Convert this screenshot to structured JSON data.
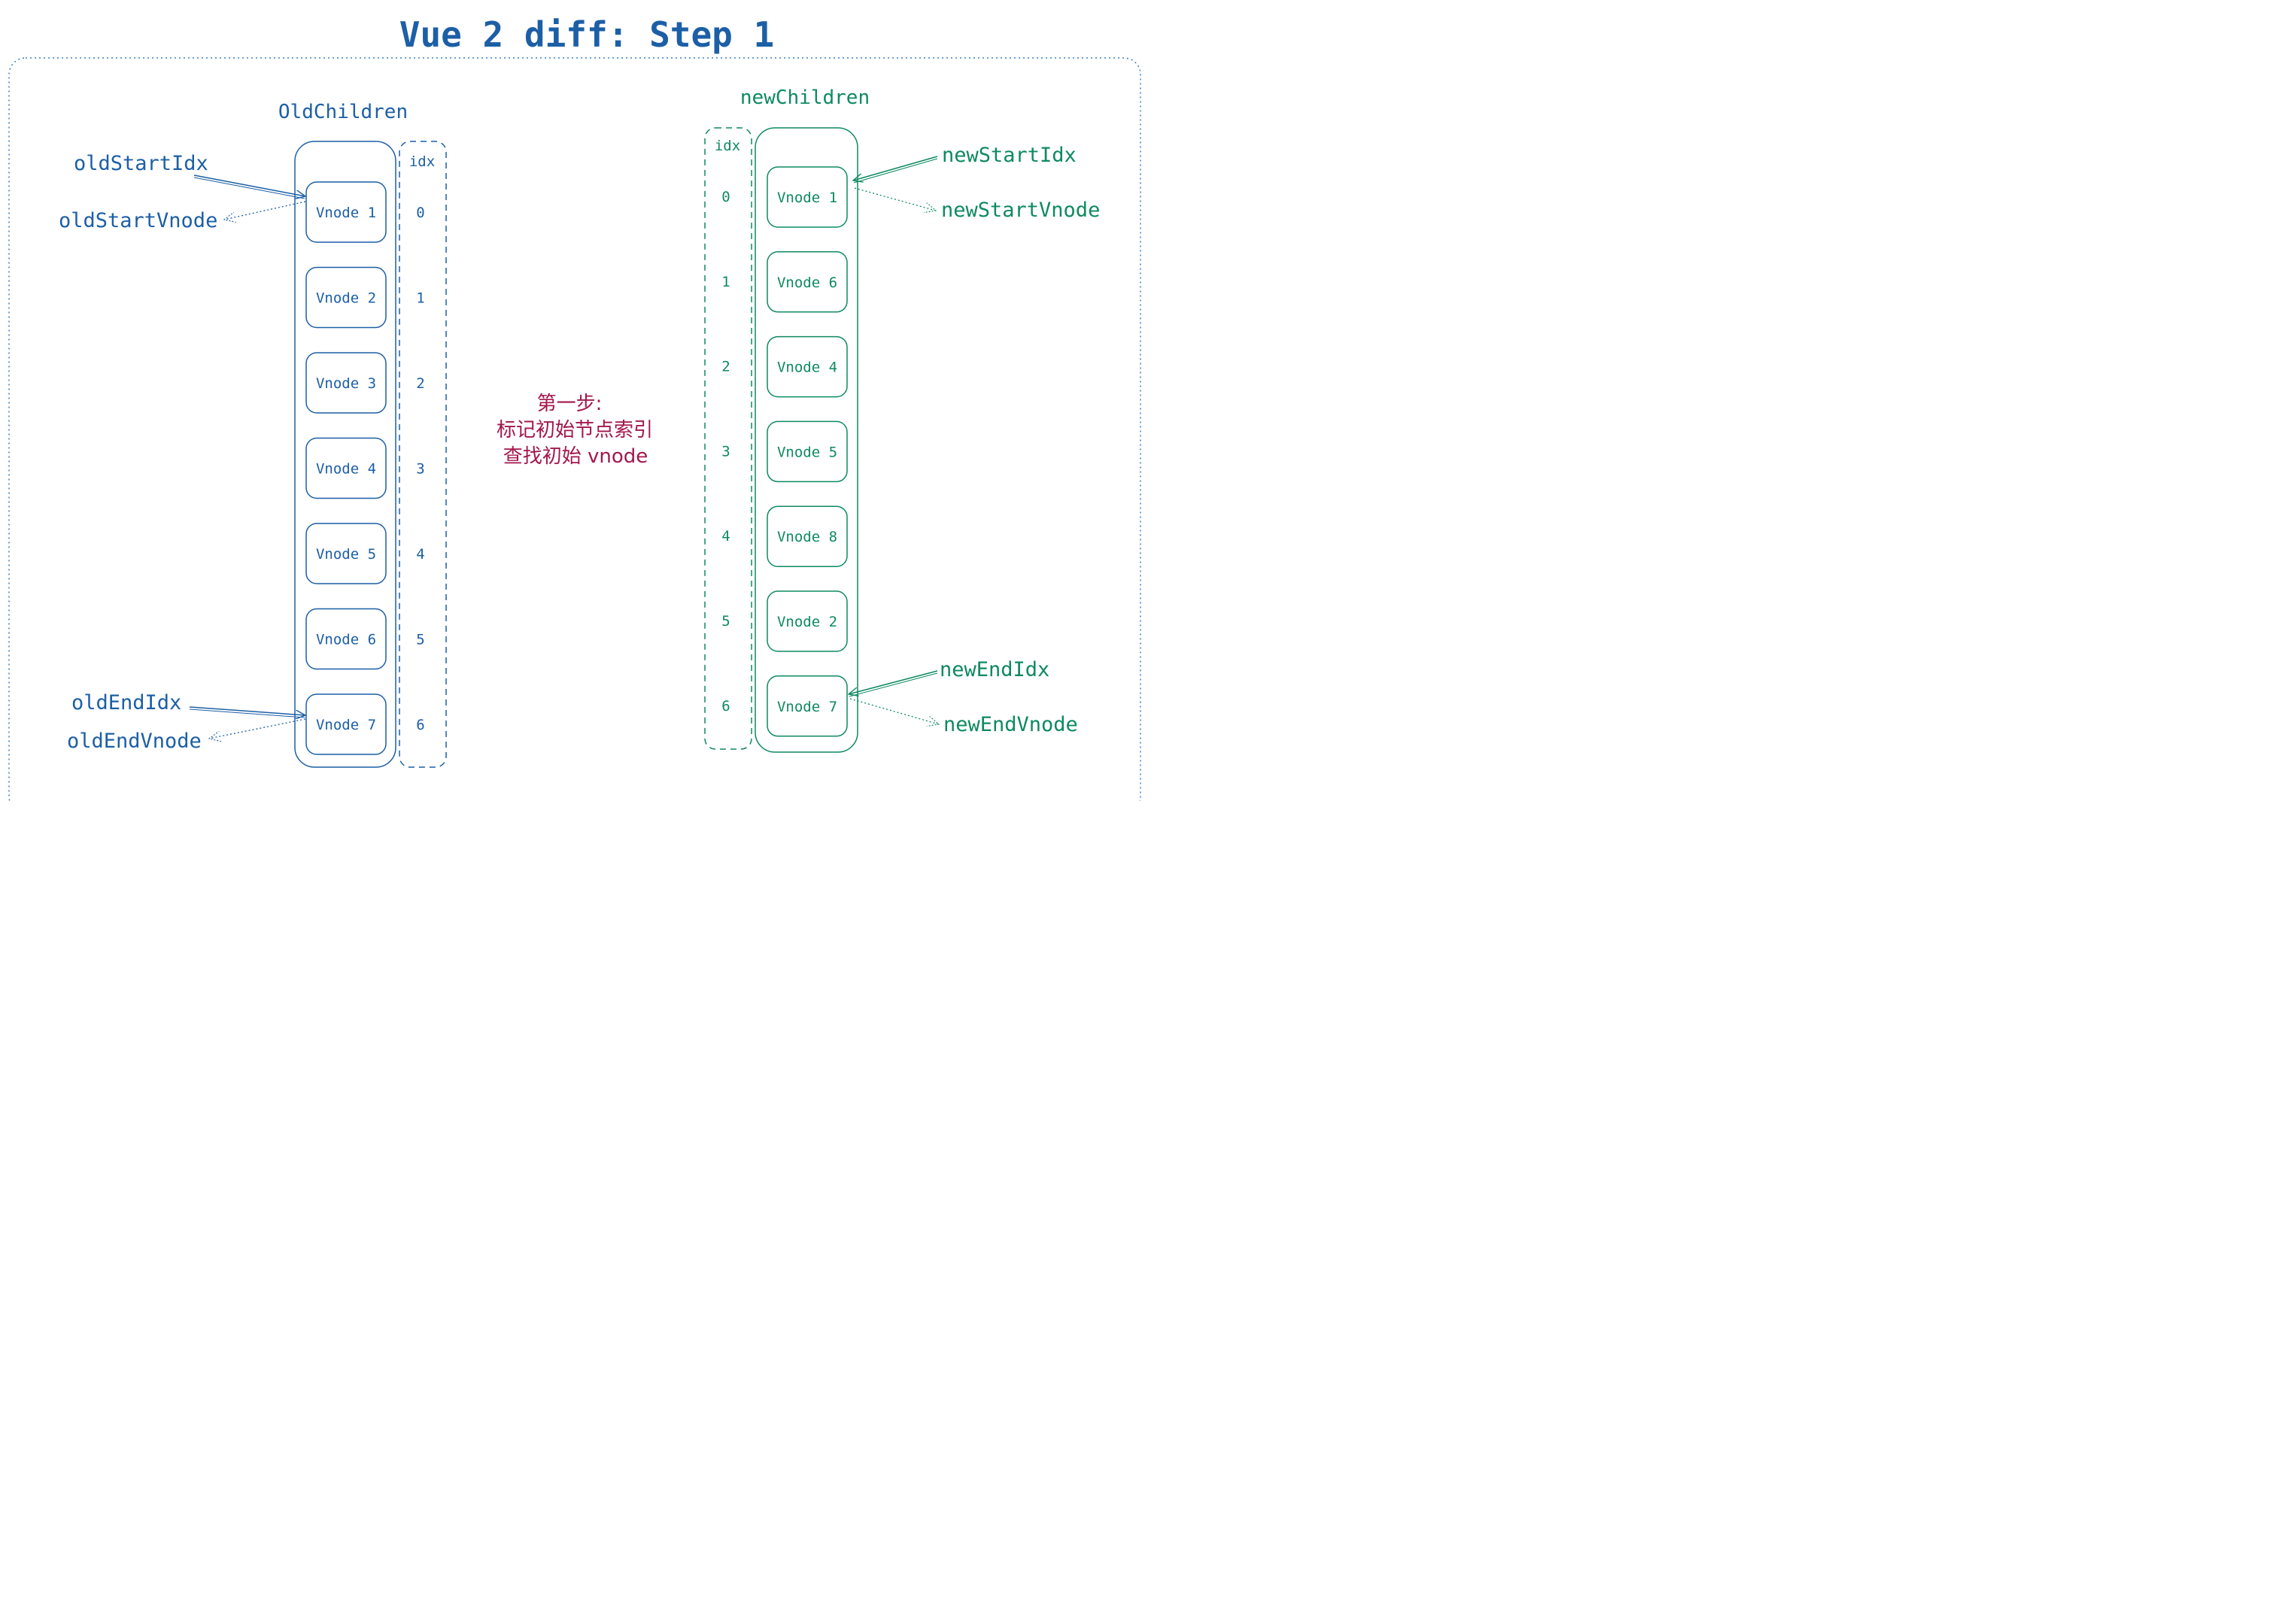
{
  "title": "Vue 2 diff: Step 1",
  "colors": {
    "blue": "#1c5fa6",
    "green": "#0e8a5f",
    "crimson": "#a3174a",
    "frame": "#3a7fc0"
  },
  "old": {
    "heading": "OldChildren",
    "idx_header": "idx",
    "nodes": [
      "Vnode 1",
      "Vnode 2",
      "Vnode 3",
      "Vnode 4",
      "Vnode 5",
      "Vnode 6",
      "Vnode 7"
    ],
    "indices": [
      "0",
      "1",
      "2",
      "3",
      "4",
      "5",
      "6"
    ],
    "pointers": {
      "start_idx": "oldStartIdx",
      "start_vnode": "oldStartVnode",
      "end_idx": "oldEndIdx",
      "end_vnode": "oldEndVnode"
    }
  },
  "new": {
    "heading": "newChildren",
    "idx_header": "idx",
    "nodes": [
      "Vnode 1",
      "Vnode 6",
      "Vnode 4",
      "Vnode 5",
      "Vnode 8",
      "Vnode 2",
      "Vnode 7"
    ],
    "indices": [
      "0",
      "1",
      "2",
      "3",
      "4",
      "5",
      "6"
    ],
    "pointers": {
      "start_idx": "newStartIdx",
      "start_vnode": "newStartVnode",
      "end_idx": "newEndIdx",
      "end_vnode": "newEndVnode"
    }
  },
  "note": {
    "line1": "第一步:",
    "line2": "标记初始节点索引",
    "line3": "查找初始 vnode"
  }
}
